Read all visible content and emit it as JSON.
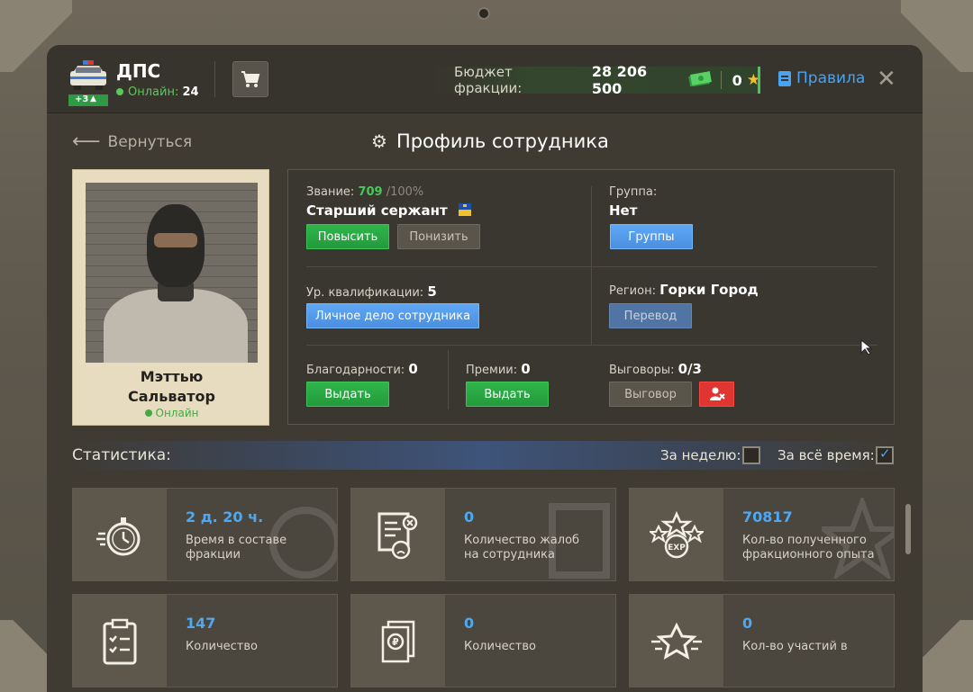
{
  "header": {
    "faction_name": "ДПС",
    "faction_badge": "+3",
    "online_label": "Онлайн:",
    "online_count": "24",
    "budget_label": "Бюджет фракции:",
    "budget_value": "28 206 500",
    "stars_value": "0",
    "rules_label": "Правила"
  },
  "nav": {
    "back_label": "Вернуться",
    "page_title": "Профиль сотрудника"
  },
  "employee": {
    "first_name": "Мэттью",
    "last_name": "Сальватор",
    "status": "Онлайн"
  },
  "profile": {
    "rank_label": "Звание:",
    "rank_points": "709",
    "rank_max": "/100%",
    "rank_name": "Старший сержант",
    "promote_label": "Повысить",
    "demote_label": "Понизить",
    "group_label": "Группа:",
    "group_value": "Нет",
    "groups_button": "Группы",
    "qualification_label": "Ур. квалификации:",
    "qualification_value": "5",
    "personal_file_button": "Личное дело сотрудника",
    "region_label": "Регион:",
    "region_value": "Горки Город",
    "transfer_button": "Перевод",
    "thanks_label": "Благодарности:",
    "thanks_value": "0",
    "thanks_button": "Выдать",
    "bonus_label": "Премии:",
    "bonus_value": "0",
    "bonus_button": "Выдать",
    "reprimand_label": "Выговоры:",
    "reprimand_value": "0",
    "reprimand_max": "/3",
    "reprimand_button": "Выговор"
  },
  "stats": {
    "title": "Статистика:",
    "week_label": "За неделю:",
    "week_checked": false,
    "alltime_label": "За всё время:",
    "alltime_checked": true,
    "cards": [
      {
        "icon": "stopwatch-icon",
        "value": "2 д. 20 ч.",
        "line1": "Время в составе",
        "line2": "фракции"
      },
      {
        "icon": "complaint-document-icon",
        "value": "0",
        "line1": "Количество жалоб",
        "line2": "на сотрудника"
      },
      {
        "icon": "exp-stars-icon",
        "value": "70817",
        "line1": "Кол-во полученного",
        "line2": "фракционного опыта"
      },
      {
        "icon": "clipboard-checklist-icon",
        "value": "147",
        "line1": "Количество",
        "line2": ""
      },
      {
        "icon": "ruble-documents-icon",
        "value": "0",
        "line1": "Количество",
        "line2": ""
      },
      {
        "icon": "star-award-icon",
        "value": "0",
        "line1": "Кол-во участий в",
        "line2": ""
      }
    ]
  },
  "colors": {
    "accent_blue": "#4ea8f2",
    "online_green": "#48c85a",
    "button_green": "#2fb54a",
    "button_red": "#e03531",
    "star_gold": "#f3c02d"
  }
}
